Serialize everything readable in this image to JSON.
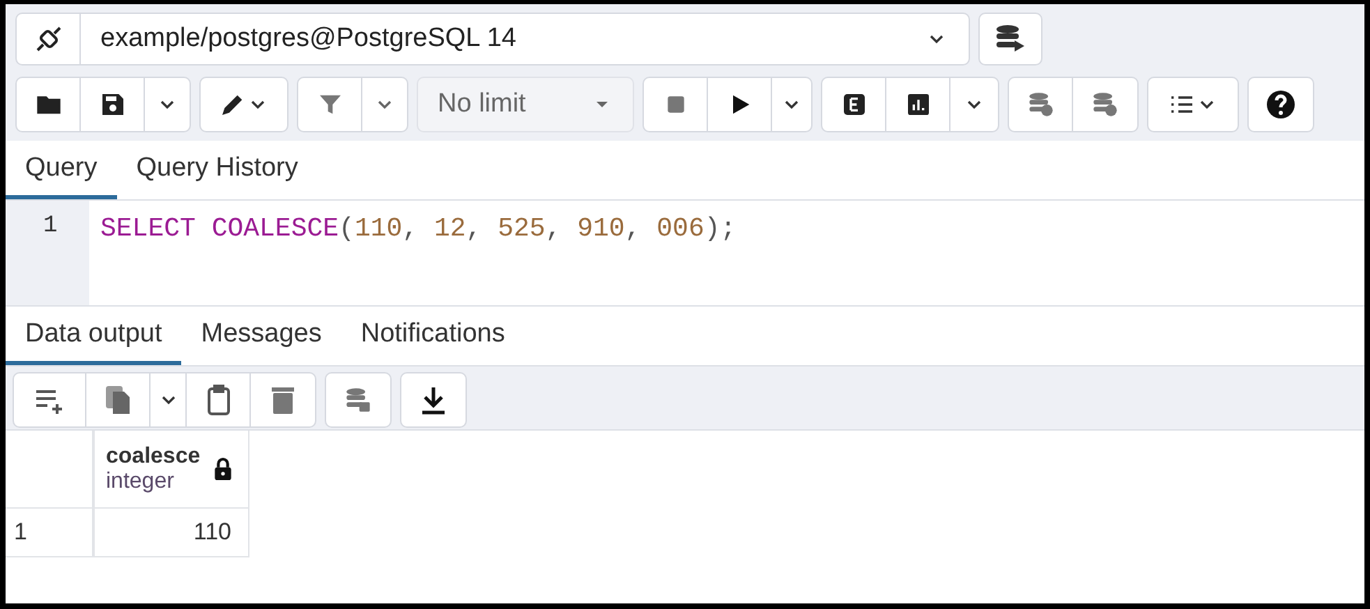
{
  "connection": {
    "label": "example/postgres@PostgreSQL 14"
  },
  "toolbar": {
    "limit": "No limit"
  },
  "editor_tabs": [
    {
      "label": "Query",
      "selected": true
    },
    {
      "label": "Query History",
      "selected": false
    }
  ],
  "editor": {
    "lines": [
      {
        "number": "1",
        "tokens": [
          {
            "kind": "keyword",
            "text": "SELECT COALESCE"
          },
          {
            "kind": "punct",
            "text": "("
          },
          {
            "kind": "number",
            "text": "110"
          },
          {
            "kind": "punct",
            "text": ", "
          },
          {
            "kind": "number",
            "text": "12"
          },
          {
            "kind": "punct",
            "text": ", "
          },
          {
            "kind": "number",
            "text": "525"
          },
          {
            "kind": "punct",
            "text": ", "
          },
          {
            "kind": "number",
            "text": "910"
          },
          {
            "kind": "punct",
            "text": ", "
          },
          {
            "kind": "number",
            "text": "006"
          },
          {
            "kind": "punct",
            "text": ");"
          }
        ]
      }
    ]
  },
  "output_tabs": [
    {
      "label": "Data output",
      "selected": true
    },
    {
      "label": "Messages",
      "selected": false
    },
    {
      "label": "Notifications",
      "selected": false
    }
  ],
  "table": {
    "columns": [
      {
        "name": "coalesce",
        "type": "integer",
        "locked": true
      }
    ],
    "rows": [
      {
        "number": "1",
        "cells": [
          "110"
        ]
      }
    ]
  }
}
